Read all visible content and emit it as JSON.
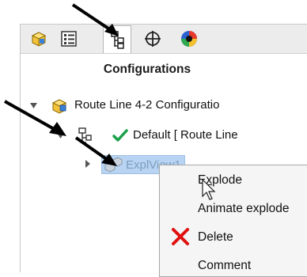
{
  "panel": {
    "title": "Configurations",
    "tabs": [
      {
        "icon": "part-icon"
      },
      {
        "icon": "property-manager-icon"
      },
      {
        "icon": "configuration-manager-icon",
        "active": true
      },
      {
        "icon": "dimxpert-icon"
      },
      {
        "icon": "display-manager-icon"
      }
    ]
  },
  "tree": {
    "root_label": "Route Line 4-2 Configuratio",
    "default_label": "Default [ Route Line",
    "explview_label": "ExplView1"
  },
  "context_menu": {
    "items": [
      {
        "label": "Explode",
        "underline_char": "x"
      },
      {
        "label": "Animate explode"
      },
      {
        "label": "Delete",
        "icon": "delete-icon"
      },
      {
        "label": "Comment"
      }
    ]
  },
  "colors": {
    "accent_green": "#1aa04a",
    "delete_red": "#e01010",
    "selection": "#b8d4f2"
  }
}
